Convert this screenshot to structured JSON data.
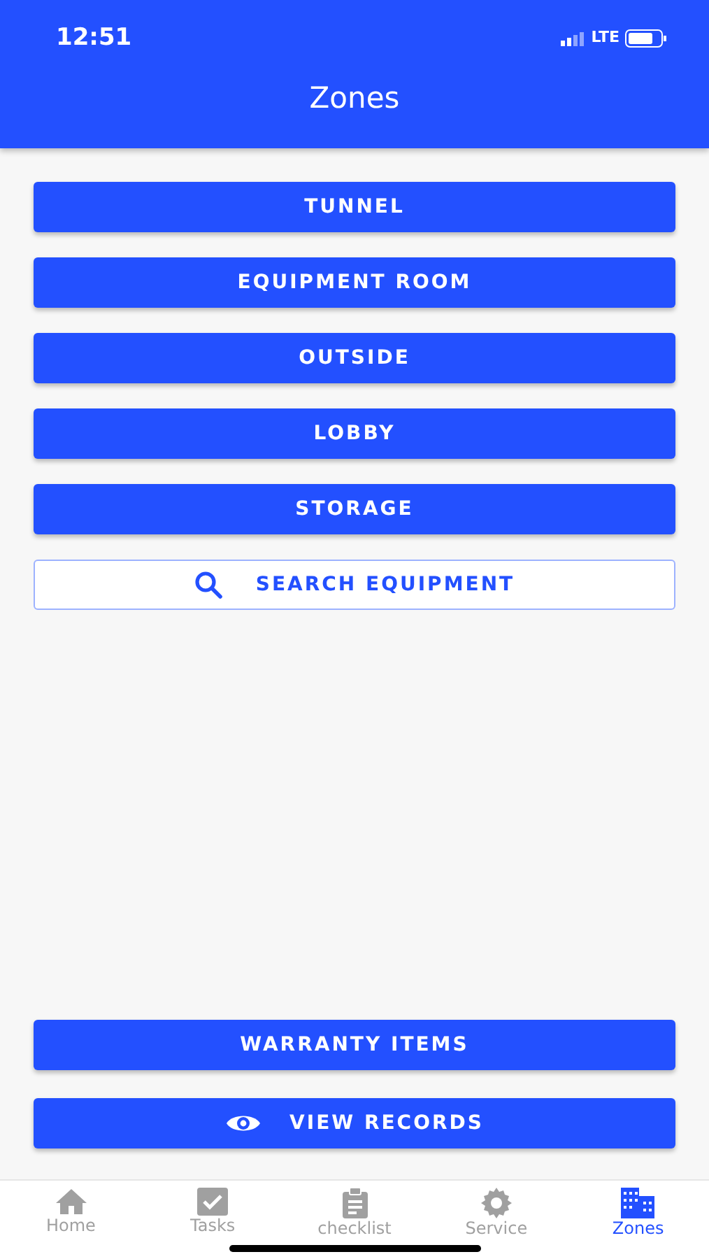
{
  "status_bar": {
    "time": "12:51",
    "network": "LTE"
  },
  "header": {
    "title": "Zones"
  },
  "zones": [
    {
      "label": "TUNNEL"
    },
    {
      "label": "EQUIPMENT ROOM"
    },
    {
      "label": "OUTSIDE"
    },
    {
      "label": "LOBBY"
    },
    {
      "label": "STORAGE"
    }
  ],
  "search_button": {
    "label": "SEARCH EQUIPMENT"
  },
  "bottom_buttons": [
    {
      "label": "WARRANTY ITEMS"
    },
    {
      "label": "VIEW RECORDS"
    }
  ],
  "tab_bar": [
    {
      "label": "Home",
      "selected": false
    },
    {
      "label": "Tasks",
      "selected": false
    },
    {
      "label": "checklist",
      "selected": false
    },
    {
      "label": "Service",
      "selected": false
    },
    {
      "label": "Zones",
      "selected": true
    }
  ]
}
